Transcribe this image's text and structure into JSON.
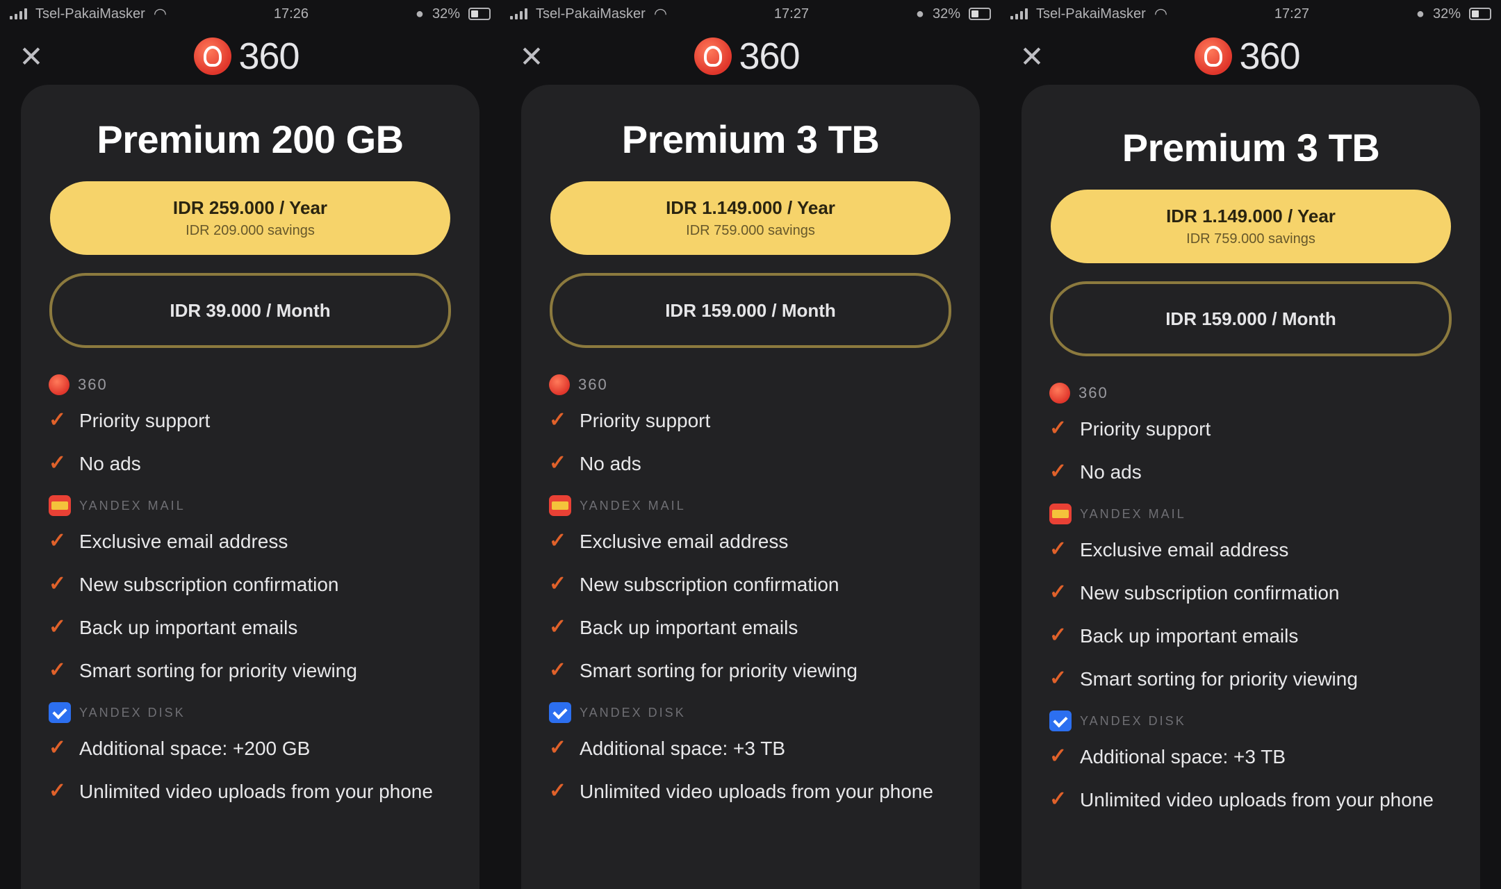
{
  "screens": [
    {
      "status": {
        "carrier": "Tsel-PakaiMasker",
        "time": "17:26",
        "battery": "32%"
      },
      "close_glyph": "✕",
      "logo_text": "360",
      "plan_title": "Premium 200 GB",
      "year_price": "IDR 259.000 / Year",
      "year_savings": "IDR 209.000 savings",
      "month_price": "IDR 39.000 / Month",
      "sections": [
        {
          "icon": "360-logo-icon",
          "label": "360",
          "features": [
            "Priority support",
            "No ads"
          ]
        },
        {
          "icon": "yandex-mail-icon",
          "label": "YANDEX MAIL",
          "features": [
            "Exclusive email address",
            "New subscription confirmation",
            "Back up important emails",
            "Smart sorting for priority viewing"
          ]
        },
        {
          "icon": "yandex-disk-icon",
          "label": "YANDEX DISK",
          "features": [
            "Additional space: +200 GB",
            "Unlimited video uploads from your phone"
          ]
        }
      ]
    },
    {
      "status": {
        "carrier": "Tsel-PakaiMasker",
        "time": "17:27",
        "battery": "32%"
      },
      "close_glyph": "✕",
      "logo_text": "360",
      "plan_title": "Premium 3 TB",
      "year_price": "IDR 1.149.000 / Year",
      "year_savings": "IDR 759.000 savings",
      "month_price": "IDR 159.000 / Month",
      "sections": [
        {
          "icon": "360-logo-icon",
          "label": "360",
          "features": [
            "Priority support",
            "No ads"
          ]
        },
        {
          "icon": "yandex-mail-icon",
          "label": "YANDEX MAIL",
          "features": [
            "Exclusive email address",
            "New subscription confirmation",
            "Back up important emails",
            "Smart sorting for priority viewing"
          ]
        },
        {
          "icon": "yandex-disk-icon",
          "label": "YANDEX DISK",
          "features": [
            "Additional space: +3 TB",
            "Unlimited video uploads from your phone"
          ]
        }
      ]
    },
    {
      "status": {
        "carrier": "Tsel-PakaiMasker",
        "time": "17:27",
        "battery": "32%"
      },
      "close_glyph": "✕",
      "logo_text": "360",
      "plan_title": "Premium 3 TB",
      "year_price": "IDR 1.149.000 / Year",
      "year_savings": "IDR 759.000 savings",
      "month_price": "IDR 159.000 / Month",
      "sections": [
        {
          "icon": "360-logo-icon",
          "label": "360",
          "features": [
            "Priority support",
            "No ads"
          ]
        },
        {
          "icon": "yandex-mail-icon",
          "label": "YANDEX MAIL",
          "features": [
            "Exclusive email address",
            "New subscription confirmation",
            "Back up important emails",
            "Smart sorting for priority viewing"
          ]
        },
        {
          "icon": "yandex-disk-icon",
          "label": "YANDEX DISK",
          "features": [
            "Additional space: +3 TB",
            "Unlimited video uploads from your phone"
          ]
        }
      ]
    }
  ],
  "colors": {
    "background": "#121214",
    "card": "#222224",
    "accent_yellow": "#f6d36a",
    "outline": "#8c7a3e",
    "check": "#e0612a"
  },
  "check_glyph": "✓"
}
